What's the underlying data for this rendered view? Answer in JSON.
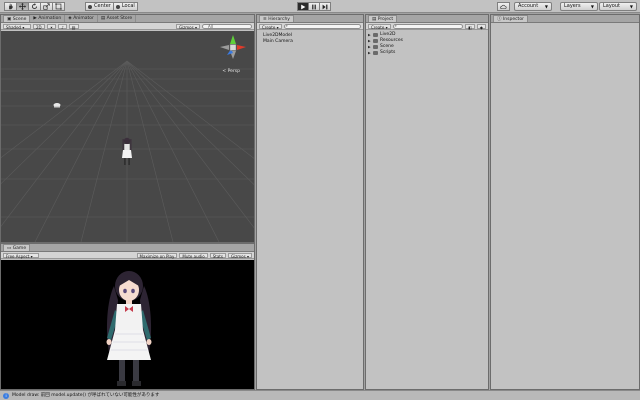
{
  "toolbar": {
    "tools": [
      "hand-tool",
      "move-tool",
      "rotate-tool",
      "scale-tool",
      "rect-tool"
    ],
    "pivot_label": "Center",
    "space_label": "Local",
    "play_icon": "play-icon",
    "pause_icon": "pause-icon",
    "step_icon": "step-icon",
    "cloud_icon": "cloud-icon",
    "account_label": "Account",
    "layers_label": "Layers",
    "layout_label": "Layout"
  },
  "scene_panel": {
    "tabs": [
      "Scene",
      "Animation",
      "Animator",
      "Asset Store"
    ],
    "shading_label": "Shaded",
    "mode_label": "2D",
    "gizmos_label": "Gizmos",
    "search_placeholder": "All",
    "persp_label": "< Persp"
  },
  "game_panel": {
    "tab": "Game",
    "display_label": "Free Aspect",
    "maximize_label": "Maximize on Play",
    "mute_label": "Mute audio",
    "stats_label": "Stats",
    "gizmos_label": "Gizmos"
  },
  "hierarchy": {
    "tab": "Hierarchy",
    "create_label": "Create",
    "items": [
      "Live2DModel",
      "Main Camera"
    ]
  },
  "project": {
    "tab": "Project",
    "create_label": "Create",
    "items": [
      "Live2D",
      "Resources",
      "Scene",
      "Scripts"
    ]
  },
  "inspector": {
    "tab": "Inspector"
  },
  "status": {
    "message": "Model draw: 前回 model.update() が呼ばれていない可能性があります",
    "icon": "info-icon"
  },
  "colors": {
    "scene_bg": "#484848",
    "game_bg": "#000000",
    "panel_bg": "#c2c2c2",
    "gizmo_y": "#5fcf3a",
    "gizmo_x": "#e03a2a",
    "gizmo_z": "#3a7ae0"
  }
}
